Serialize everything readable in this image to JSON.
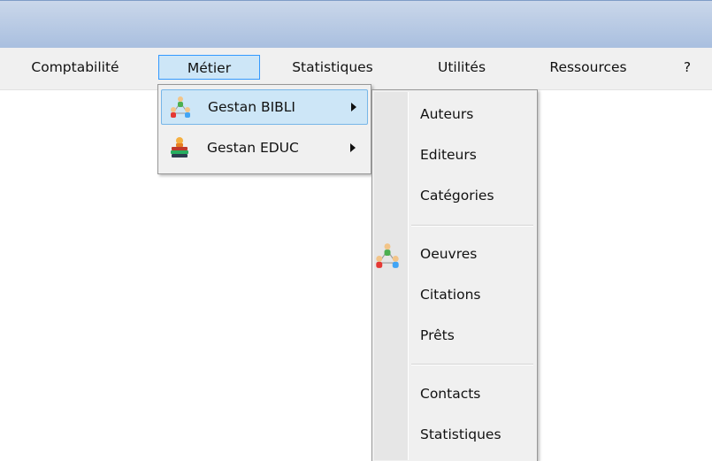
{
  "menubar": {
    "items": [
      {
        "label": "Comptabilité"
      },
      {
        "label": "Métier"
      },
      {
        "label": "Statistiques"
      },
      {
        "label": "Utilités"
      },
      {
        "label": "Ressources"
      },
      {
        "label": "?"
      }
    ]
  },
  "metier_menu": {
    "items": [
      {
        "label": "Gestan BIBLI",
        "icon": "people-network-icon"
      },
      {
        "label": "Gestan EDUC",
        "icon": "books-stack-icon"
      }
    ]
  },
  "bibli_submenu": {
    "items": [
      {
        "label": "Auteurs"
      },
      {
        "label": "Editeurs"
      },
      {
        "label": "Catégories"
      },
      {
        "label": "Oeuvres",
        "icon": "people-network-icon"
      },
      {
        "label": "Citations"
      },
      {
        "label": "Prêts"
      },
      {
        "label": "Contacts"
      },
      {
        "label": "Statistiques"
      }
    ]
  },
  "colors": {
    "highlight_bg": "#cde6f7",
    "highlight_border": "#3399ff",
    "menu_bg": "#f0f0f0",
    "title_gradient_top": "#cad7ea",
    "title_gradient_bottom": "#a9bfdf"
  }
}
